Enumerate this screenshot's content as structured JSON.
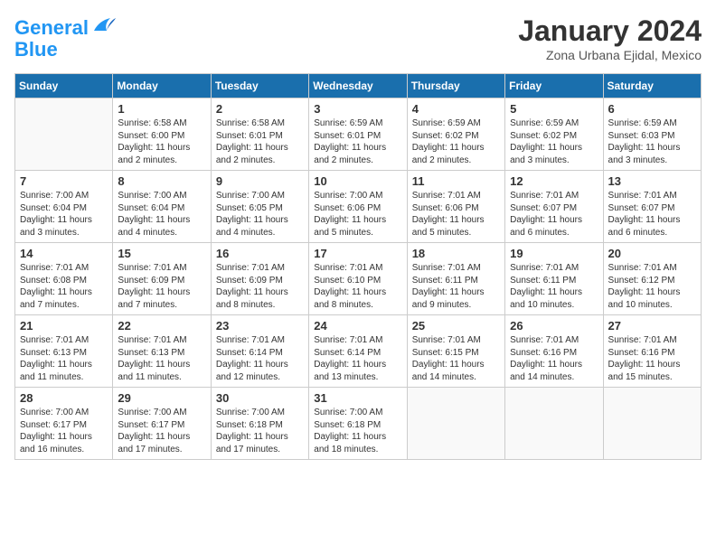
{
  "header": {
    "logo_line1": "General",
    "logo_line2": "Blue",
    "month": "January 2024",
    "location": "Zona Urbana Ejidal, Mexico"
  },
  "weekdays": [
    "Sunday",
    "Monday",
    "Tuesday",
    "Wednesday",
    "Thursday",
    "Friday",
    "Saturday"
  ],
  "weeks": [
    [
      {
        "day": "",
        "sunrise": "",
        "sunset": "",
        "daylight": ""
      },
      {
        "day": "1",
        "sunrise": "6:58 AM",
        "sunset": "6:00 PM",
        "daylight": "11 hours and 2 minutes."
      },
      {
        "day": "2",
        "sunrise": "6:58 AM",
        "sunset": "6:01 PM",
        "daylight": "11 hours and 2 minutes."
      },
      {
        "day": "3",
        "sunrise": "6:59 AM",
        "sunset": "6:01 PM",
        "daylight": "11 hours and 2 minutes."
      },
      {
        "day": "4",
        "sunrise": "6:59 AM",
        "sunset": "6:02 PM",
        "daylight": "11 hours and 2 minutes."
      },
      {
        "day": "5",
        "sunrise": "6:59 AM",
        "sunset": "6:02 PM",
        "daylight": "11 hours and 3 minutes."
      },
      {
        "day": "6",
        "sunrise": "6:59 AM",
        "sunset": "6:03 PM",
        "daylight": "11 hours and 3 minutes."
      }
    ],
    [
      {
        "day": "7",
        "sunrise": "7:00 AM",
        "sunset": "6:04 PM",
        "daylight": "11 hours and 3 minutes."
      },
      {
        "day": "8",
        "sunrise": "7:00 AM",
        "sunset": "6:04 PM",
        "daylight": "11 hours and 4 minutes."
      },
      {
        "day": "9",
        "sunrise": "7:00 AM",
        "sunset": "6:05 PM",
        "daylight": "11 hours and 4 minutes."
      },
      {
        "day": "10",
        "sunrise": "7:00 AM",
        "sunset": "6:06 PM",
        "daylight": "11 hours and 5 minutes."
      },
      {
        "day": "11",
        "sunrise": "7:01 AM",
        "sunset": "6:06 PM",
        "daylight": "11 hours and 5 minutes."
      },
      {
        "day": "12",
        "sunrise": "7:01 AM",
        "sunset": "6:07 PM",
        "daylight": "11 hours and 6 minutes."
      },
      {
        "day": "13",
        "sunrise": "7:01 AM",
        "sunset": "6:07 PM",
        "daylight": "11 hours and 6 minutes."
      }
    ],
    [
      {
        "day": "14",
        "sunrise": "7:01 AM",
        "sunset": "6:08 PM",
        "daylight": "11 hours and 7 minutes."
      },
      {
        "day": "15",
        "sunrise": "7:01 AM",
        "sunset": "6:09 PM",
        "daylight": "11 hours and 7 minutes."
      },
      {
        "day": "16",
        "sunrise": "7:01 AM",
        "sunset": "6:09 PM",
        "daylight": "11 hours and 8 minutes."
      },
      {
        "day": "17",
        "sunrise": "7:01 AM",
        "sunset": "6:10 PM",
        "daylight": "11 hours and 8 minutes."
      },
      {
        "day": "18",
        "sunrise": "7:01 AM",
        "sunset": "6:11 PM",
        "daylight": "11 hours and 9 minutes."
      },
      {
        "day": "19",
        "sunrise": "7:01 AM",
        "sunset": "6:11 PM",
        "daylight": "11 hours and 10 minutes."
      },
      {
        "day": "20",
        "sunrise": "7:01 AM",
        "sunset": "6:12 PM",
        "daylight": "11 hours and 10 minutes."
      }
    ],
    [
      {
        "day": "21",
        "sunrise": "7:01 AM",
        "sunset": "6:13 PM",
        "daylight": "11 hours and 11 minutes."
      },
      {
        "day": "22",
        "sunrise": "7:01 AM",
        "sunset": "6:13 PM",
        "daylight": "11 hours and 11 minutes."
      },
      {
        "day": "23",
        "sunrise": "7:01 AM",
        "sunset": "6:14 PM",
        "daylight": "11 hours and 12 minutes."
      },
      {
        "day": "24",
        "sunrise": "7:01 AM",
        "sunset": "6:14 PM",
        "daylight": "11 hours and 13 minutes."
      },
      {
        "day": "25",
        "sunrise": "7:01 AM",
        "sunset": "6:15 PM",
        "daylight": "11 hours and 14 minutes."
      },
      {
        "day": "26",
        "sunrise": "7:01 AM",
        "sunset": "6:16 PM",
        "daylight": "11 hours and 14 minutes."
      },
      {
        "day": "27",
        "sunrise": "7:01 AM",
        "sunset": "6:16 PM",
        "daylight": "11 hours and 15 minutes."
      }
    ],
    [
      {
        "day": "28",
        "sunrise": "7:00 AM",
        "sunset": "6:17 PM",
        "daylight": "11 hours and 16 minutes."
      },
      {
        "day": "29",
        "sunrise": "7:00 AM",
        "sunset": "6:17 PM",
        "daylight": "11 hours and 17 minutes."
      },
      {
        "day": "30",
        "sunrise": "7:00 AM",
        "sunset": "6:18 PM",
        "daylight": "11 hours and 17 minutes."
      },
      {
        "day": "31",
        "sunrise": "7:00 AM",
        "sunset": "6:18 PM",
        "daylight": "11 hours and 18 minutes."
      },
      {
        "day": "",
        "sunrise": "",
        "sunset": "",
        "daylight": ""
      },
      {
        "day": "",
        "sunrise": "",
        "sunset": "",
        "daylight": ""
      },
      {
        "day": "",
        "sunrise": "",
        "sunset": "",
        "daylight": ""
      }
    ]
  ]
}
